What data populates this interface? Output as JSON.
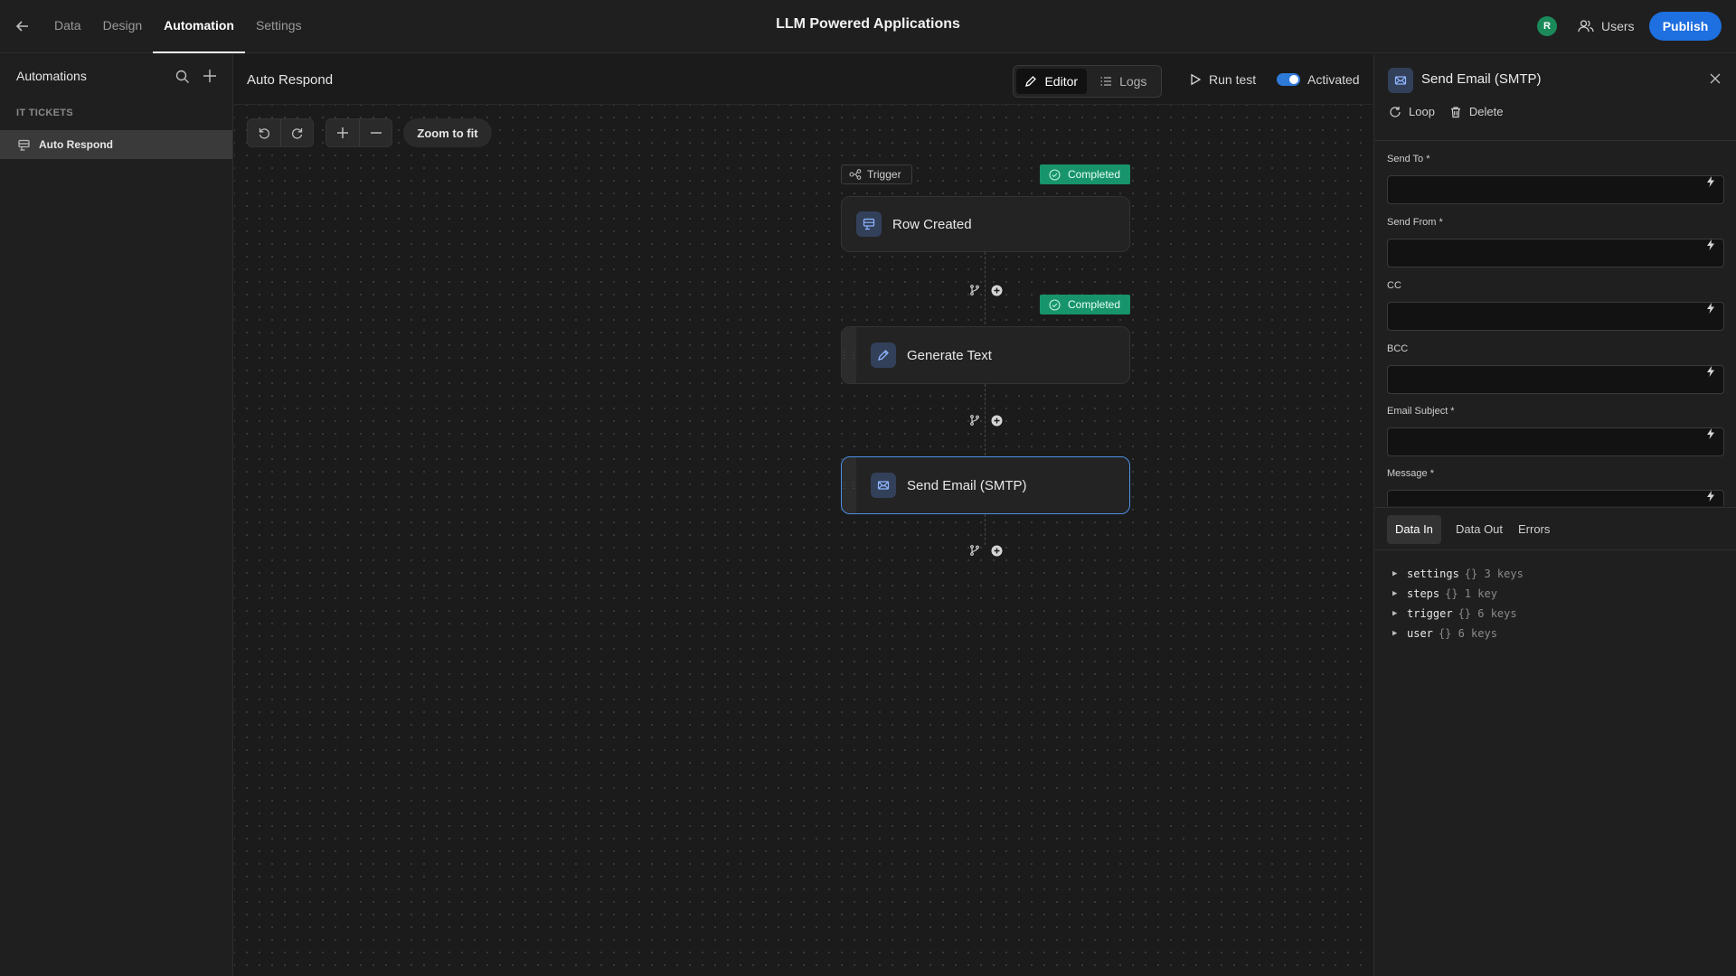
{
  "topbar": {
    "nav_tabs": [
      {
        "label": "Data"
      },
      {
        "label": "Design"
      },
      {
        "label": "Automation"
      },
      {
        "label": "Settings"
      }
    ],
    "app_title": "LLM Powered Applications",
    "avatar_initial": "R",
    "users_label": "Users",
    "publish_label": "Publish"
  },
  "sidebar": {
    "title": "Automations",
    "section": "IT TICKETS",
    "items": [
      {
        "label": "Auto Respond"
      }
    ]
  },
  "canvas": {
    "automation_name": "Auto Respond",
    "editor_label": "Editor",
    "logs_label": "Logs",
    "run_test_label": "Run test",
    "activated_label": "Activated",
    "zoom_to_fit_label": "Zoom to fit",
    "trigger_tag": "Trigger",
    "completed_label": "Completed",
    "nodes": [
      {
        "title": "Row Created"
      },
      {
        "title": "Generate Text"
      },
      {
        "title": "Send Email (SMTP)"
      }
    ]
  },
  "panel": {
    "title": "Send Email (SMTP)",
    "loop_label": "Loop",
    "delete_label": "Delete",
    "fields": [
      {
        "label": "Send To *",
        "value": ""
      },
      {
        "label": "Send From *",
        "value": ""
      },
      {
        "label": "CC",
        "value": ""
      },
      {
        "label": "BCC",
        "value": ""
      },
      {
        "label": "Email Subject *",
        "value": ""
      },
      {
        "label": "Message *",
        "value": ""
      }
    ],
    "data_tabs": [
      {
        "label": "Data In"
      },
      {
        "label": "Data Out"
      },
      {
        "label": "Errors"
      }
    ],
    "tree": [
      {
        "key": "settings",
        "meta": "{} 3 keys"
      },
      {
        "key": "steps",
        "meta": "{} 1 key"
      },
      {
        "key": "trigger",
        "meta": "{} 6 keys"
      },
      {
        "key": "user",
        "meta": "{} 6 keys"
      }
    ]
  },
  "colors": {
    "accent": "#1e6fe0",
    "completed": "#17946b",
    "selected_border": "#4d8fe6"
  }
}
